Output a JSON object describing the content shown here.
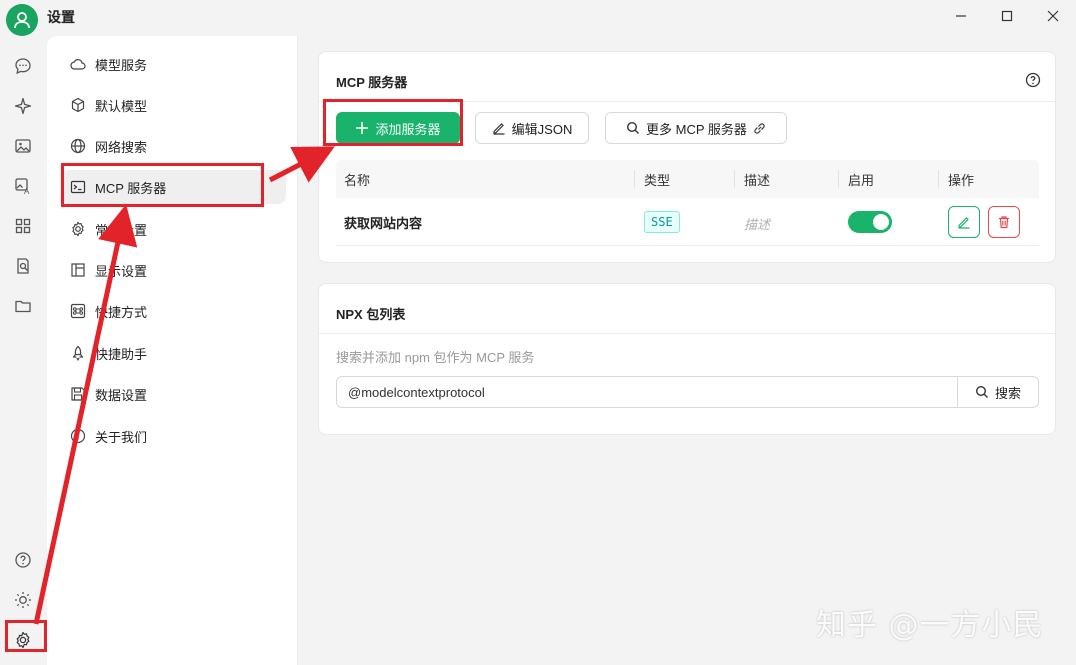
{
  "window": {
    "title": "设置"
  },
  "rail": {
    "items": [
      {
        "icon": "chat-icon"
      },
      {
        "icon": "sparkle-icon"
      },
      {
        "icon": "image-icon"
      },
      {
        "icon": "image-edit-icon"
      },
      {
        "icon": "apps-grid-icon"
      },
      {
        "icon": "doc-search-icon"
      },
      {
        "icon": "folder-icon"
      }
    ],
    "bottom": [
      {
        "icon": "help-icon"
      },
      {
        "icon": "theme-sun-icon"
      },
      {
        "icon": "settings-gear-icon"
      }
    ]
  },
  "menu": {
    "items": [
      {
        "label": "模型服务",
        "icon": "cloud-icon"
      },
      {
        "label": "默认模型",
        "icon": "cube-icon"
      },
      {
        "label": "网络搜索",
        "icon": "globe-icon"
      },
      {
        "label": "MCP 服务器",
        "icon": "terminal-icon"
      },
      {
        "label": "常规设置",
        "icon": "gear-icon"
      },
      {
        "label": "显示设置",
        "icon": "layout-icon"
      },
      {
        "label": "快捷方式",
        "icon": "command-key-icon"
      },
      {
        "label": "快捷助手",
        "icon": "rocket-icon"
      },
      {
        "label": "数据设置",
        "icon": "save-disk-icon"
      },
      {
        "label": "关于我们",
        "icon": "info-icon"
      }
    ],
    "active_index": 3
  },
  "mcp": {
    "title": "MCP 服务器",
    "add_button": "添加服务器",
    "edit_json_button": "编辑JSON",
    "more_button": "更多 MCP 服务器",
    "columns": [
      "名称",
      "类型",
      "描述",
      "启用",
      "操作"
    ],
    "rows": [
      {
        "name": "获取网站内容",
        "type": "SSE",
        "description": "描述",
        "enabled": true
      }
    ]
  },
  "npx": {
    "title": "NPX 包列表",
    "subtitle": "搜索并添加 npm 包作为 MCP 服务",
    "search_value": "@modelcontextprotocol",
    "search_button": "搜索"
  },
  "watermark": "知乎 @一方小民",
  "colors": {
    "accent": "#1ab36b",
    "annotation": "#e3232a",
    "danger": "#e5484d"
  }
}
